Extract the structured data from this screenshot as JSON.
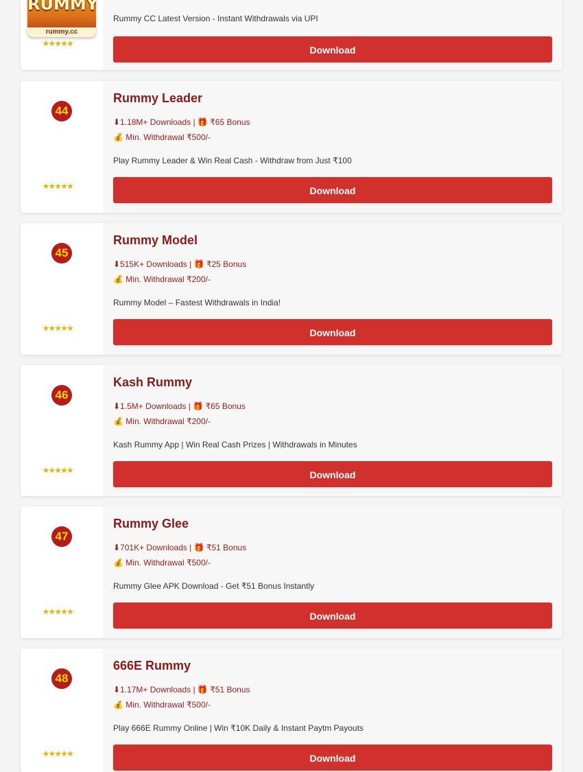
{
  "first_card": {
    "logo_text": "RUMMY",
    "logo_url": "rummy.cc",
    "stars": "★★★★★",
    "tagline": "Rummy CC Latest Version - Instant Withdrawals via UPI",
    "download_label": "Download"
  },
  "apps": [
    {
      "rank": "44",
      "name": "Rummy Leader",
      "downloads_line": "⬇1.18M+ Downloads | 🎁 ₹65 Bonus",
      "withdrawal_line": "💰 Min. Withdrawal ₹500/-",
      "tagline": "Play Rummy Leader & Win Real Cash - Withdraw from Just ₹100",
      "stars": "★★★★★",
      "download_label": "Download"
    },
    {
      "rank": "45",
      "name": "Rummy Model",
      "downloads_line": "⬇515K+ Downloads | 🎁 ₹25 Bonus",
      "withdrawal_line": "💰 Min. Withdrawal ₹200/-",
      "tagline": "Rummy Model – Fastest Withdrawals in India!",
      "stars": "★★★★★",
      "download_label": "Download"
    },
    {
      "rank": "46",
      "name": "Kash Rummy",
      "downloads_line": "⬇1.5M+ Downloads | 🎁 ₹65 Bonus",
      "withdrawal_line": "💰 Min. Withdrawal ₹200/-",
      "tagline": "Kash Rummy App | Win Real Cash Prizes | Withdrawals in Minutes",
      "stars": "★★★★★",
      "download_label": "Download"
    },
    {
      "rank": "47",
      "name": "Rummy Glee",
      "downloads_line": "⬇701K+ Downloads | 🎁 ₹51 Bonus",
      "withdrawal_line": "💰 Min. Withdrawal ₹500/-",
      "tagline": "Rummy Glee APK Download - Get ₹51 Bonus Instantly",
      "stars": "★★★★★",
      "download_label": "Download"
    },
    {
      "rank": "48",
      "name": "666E Rummy",
      "downloads_line": "⬇1.17M+ Downloads | 🎁 ₹51 Bonus",
      "withdrawal_line": "💰 Min. Withdrawal ₹500/-",
      "tagline": "Play 666E Rummy Online | Win ₹10K Daily & Instant Paytm Payouts",
      "stars": "★★★★★",
      "download_label": "Download"
    }
  ],
  "colors": {
    "accent": "#d0312d",
    "rank_bg": "#b71c1c",
    "rank_text": "#ffd400",
    "title": "#8b1a1a"
  }
}
